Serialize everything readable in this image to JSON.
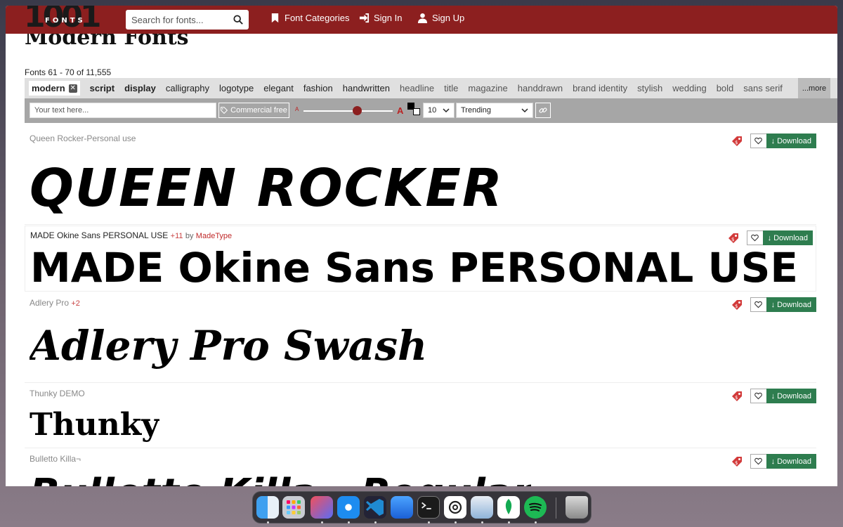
{
  "nav": {
    "logo_digits": "1001",
    "logo_word": "FONTS",
    "search_placeholder": "Search for fonts...",
    "categories": "Font Categories",
    "signin": "Sign In",
    "signup": "Sign Up"
  },
  "page": {
    "title": "Modern Fonts",
    "results": "Fonts 61 - 70 of 11,555"
  },
  "tags": {
    "active": "modern",
    "items": [
      "script",
      "display",
      "calligraphy",
      "logotype",
      "elegant",
      "fashion",
      "handwritten",
      "headline",
      "title",
      "magazine",
      "handdrawn",
      "brand identity",
      "stylish",
      "wedding",
      "bold",
      "sans serif"
    ],
    "more": "...more"
  },
  "controls": {
    "text_placeholder": "Your text here...",
    "commercial": "Commercial free",
    "size_small": "A",
    "size_big": "A",
    "count": "10",
    "sort": "Trending"
  },
  "entries": [
    {
      "name": "Queen Rocker-Personal use",
      "sample": "QUEEN ROCKER",
      "download": "Download"
    },
    {
      "name": "MADE Okine Sans PERSONAL USE",
      "plus": "+11",
      "by": "by",
      "author": "MadeType",
      "sample": "MADE Okine Sans PERSONAL USE BOLD",
      "download": "Download"
    },
    {
      "name": "Adlery Pro",
      "plus": "+2",
      "sample": "Adlery Pro Swash",
      "download": "Download"
    },
    {
      "name": "Thunky DEMO",
      "sample": "Thunky",
      "download": "Download"
    },
    {
      "name": "Bulletto Killa¬",
      "sample": "Bulletto Killa - Regular",
      "download": "Download"
    }
  ],
  "dock": {
    "apps": [
      "finder-icon",
      "launchpad-icon",
      "arc-icon",
      "safari-icon",
      "vscode-icon",
      "xcode-icon",
      "terminal-icon",
      "chatgpt-icon",
      "preview-icon",
      "mongodb-icon",
      "spotify-icon",
      "trash-icon"
    ]
  },
  "colors": {
    "brand": "#8c1f1f",
    "download": "#2e7d4f",
    "tags_bg": "#e0e0e0",
    "controls_bg": "#a6a6a6"
  }
}
